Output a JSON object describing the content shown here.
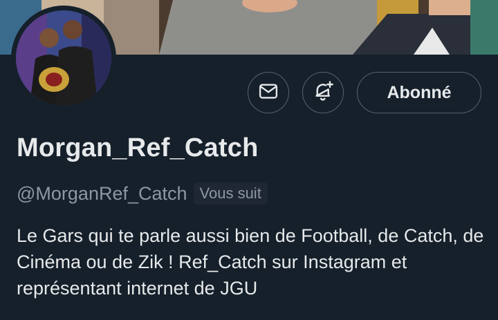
{
  "profile": {
    "display_name": "Morgan_Ref_Catch",
    "handle": "@MorganRef_Catch",
    "follows_you": "Vous suit",
    "bio": "Le Gars qui te parle aussi bien de Football, de Catch, de Cinéma ou de Zik ! Ref_Catch sur Instagram et représentant internet de JGU"
  },
  "actions": {
    "message_icon": "mail-icon",
    "notify_icon": "bell-plus-icon",
    "follow_label": "Abonné"
  },
  "colors": {
    "background": "#15202b",
    "border": "#536471",
    "secondary_text": "#8b98a5",
    "primary_text": "#e7e9ea"
  }
}
